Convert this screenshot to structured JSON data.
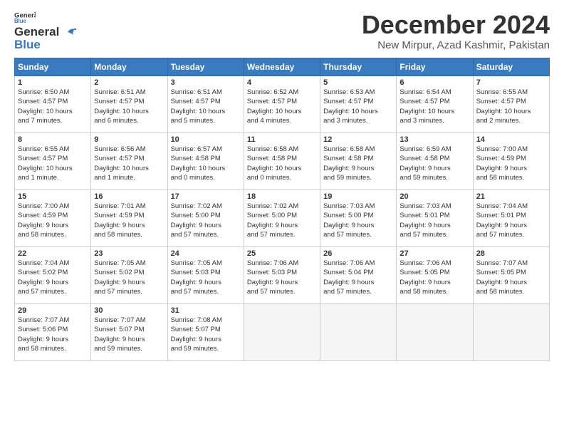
{
  "logo": {
    "line1": "General",
    "line2": "Blue"
  },
  "title": "December 2024",
  "subtitle": "New Mirpur, Azad Kashmir, Pakistan",
  "weekdays": [
    "Sunday",
    "Monday",
    "Tuesday",
    "Wednesday",
    "Thursday",
    "Friday",
    "Saturday"
  ],
  "weeks": [
    [
      {
        "day": "1",
        "lines": [
          "Sunrise: 6:50 AM",
          "Sunset: 4:57 PM",
          "Daylight: 10 hours",
          "and 7 minutes."
        ]
      },
      {
        "day": "2",
        "lines": [
          "Sunrise: 6:51 AM",
          "Sunset: 4:57 PM",
          "Daylight: 10 hours",
          "and 6 minutes."
        ]
      },
      {
        "day": "3",
        "lines": [
          "Sunrise: 6:51 AM",
          "Sunset: 4:57 PM",
          "Daylight: 10 hours",
          "and 5 minutes."
        ]
      },
      {
        "day": "4",
        "lines": [
          "Sunrise: 6:52 AM",
          "Sunset: 4:57 PM",
          "Daylight: 10 hours",
          "and 4 minutes."
        ]
      },
      {
        "day": "5",
        "lines": [
          "Sunrise: 6:53 AM",
          "Sunset: 4:57 PM",
          "Daylight: 10 hours",
          "and 3 minutes."
        ]
      },
      {
        "day": "6",
        "lines": [
          "Sunrise: 6:54 AM",
          "Sunset: 4:57 PM",
          "Daylight: 10 hours",
          "and 3 minutes."
        ]
      },
      {
        "day": "7",
        "lines": [
          "Sunrise: 6:55 AM",
          "Sunset: 4:57 PM",
          "Daylight: 10 hours",
          "and 2 minutes."
        ]
      }
    ],
    [
      {
        "day": "8",
        "lines": [
          "Sunrise: 6:55 AM",
          "Sunset: 4:57 PM",
          "Daylight: 10 hours",
          "and 1 minute."
        ]
      },
      {
        "day": "9",
        "lines": [
          "Sunrise: 6:56 AM",
          "Sunset: 4:57 PM",
          "Daylight: 10 hours",
          "and 1 minute."
        ]
      },
      {
        "day": "10",
        "lines": [
          "Sunrise: 6:57 AM",
          "Sunset: 4:58 PM",
          "Daylight: 10 hours",
          "and 0 minutes."
        ]
      },
      {
        "day": "11",
        "lines": [
          "Sunrise: 6:58 AM",
          "Sunset: 4:58 PM",
          "Daylight: 10 hours",
          "and 0 minutes."
        ]
      },
      {
        "day": "12",
        "lines": [
          "Sunrise: 6:58 AM",
          "Sunset: 4:58 PM",
          "Daylight: 9 hours",
          "and 59 minutes."
        ]
      },
      {
        "day": "13",
        "lines": [
          "Sunrise: 6:59 AM",
          "Sunset: 4:58 PM",
          "Daylight: 9 hours",
          "and 59 minutes."
        ]
      },
      {
        "day": "14",
        "lines": [
          "Sunrise: 7:00 AM",
          "Sunset: 4:59 PM",
          "Daylight: 9 hours",
          "and 58 minutes."
        ]
      }
    ],
    [
      {
        "day": "15",
        "lines": [
          "Sunrise: 7:00 AM",
          "Sunset: 4:59 PM",
          "Daylight: 9 hours",
          "and 58 minutes."
        ]
      },
      {
        "day": "16",
        "lines": [
          "Sunrise: 7:01 AM",
          "Sunset: 4:59 PM",
          "Daylight: 9 hours",
          "and 58 minutes."
        ]
      },
      {
        "day": "17",
        "lines": [
          "Sunrise: 7:02 AM",
          "Sunset: 5:00 PM",
          "Daylight: 9 hours",
          "and 57 minutes."
        ]
      },
      {
        "day": "18",
        "lines": [
          "Sunrise: 7:02 AM",
          "Sunset: 5:00 PM",
          "Daylight: 9 hours",
          "and 57 minutes."
        ]
      },
      {
        "day": "19",
        "lines": [
          "Sunrise: 7:03 AM",
          "Sunset: 5:00 PM",
          "Daylight: 9 hours",
          "and 57 minutes."
        ]
      },
      {
        "day": "20",
        "lines": [
          "Sunrise: 7:03 AM",
          "Sunset: 5:01 PM",
          "Daylight: 9 hours",
          "and 57 minutes."
        ]
      },
      {
        "day": "21",
        "lines": [
          "Sunrise: 7:04 AM",
          "Sunset: 5:01 PM",
          "Daylight: 9 hours",
          "and 57 minutes."
        ]
      }
    ],
    [
      {
        "day": "22",
        "lines": [
          "Sunrise: 7:04 AM",
          "Sunset: 5:02 PM",
          "Daylight: 9 hours",
          "and 57 minutes."
        ]
      },
      {
        "day": "23",
        "lines": [
          "Sunrise: 7:05 AM",
          "Sunset: 5:02 PM",
          "Daylight: 9 hours",
          "and 57 minutes."
        ]
      },
      {
        "day": "24",
        "lines": [
          "Sunrise: 7:05 AM",
          "Sunset: 5:03 PM",
          "Daylight: 9 hours",
          "and 57 minutes."
        ]
      },
      {
        "day": "25",
        "lines": [
          "Sunrise: 7:06 AM",
          "Sunset: 5:03 PM",
          "Daylight: 9 hours",
          "and 57 minutes."
        ]
      },
      {
        "day": "26",
        "lines": [
          "Sunrise: 7:06 AM",
          "Sunset: 5:04 PM",
          "Daylight: 9 hours",
          "and 57 minutes."
        ]
      },
      {
        "day": "27",
        "lines": [
          "Sunrise: 7:06 AM",
          "Sunset: 5:05 PM",
          "Daylight: 9 hours",
          "and 58 minutes."
        ]
      },
      {
        "day": "28",
        "lines": [
          "Sunrise: 7:07 AM",
          "Sunset: 5:05 PM",
          "Daylight: 9 hours",
          "and 58 minutes."
        ]
      }
    ],
    [
      {
        "day": "29",
        "lines": [
          "Sunrise: 7:07 AM",
          "Sunset: 5:06 PM",
          "Daylight: 9 hours",
          "and 58 minutes."
        ]
      },
      {
        "day": "30",
        "lines": [
          "Sunrise: 7:07 AM",
          "Sunset: 5:07 PM",
          "Daylight: 9 hours",
          "and 59 minutes."
        ]
      },
      {
        "day": "31",
        "lines": [
          "Sunrise: 7:08 AM",
          "Sunset: 5:07 PM",
          "Daylight: 9 hours",
          "and 59 minutes."
        ]
      },
      null,
      null,
      null,
      null
    ]
  ]
}
